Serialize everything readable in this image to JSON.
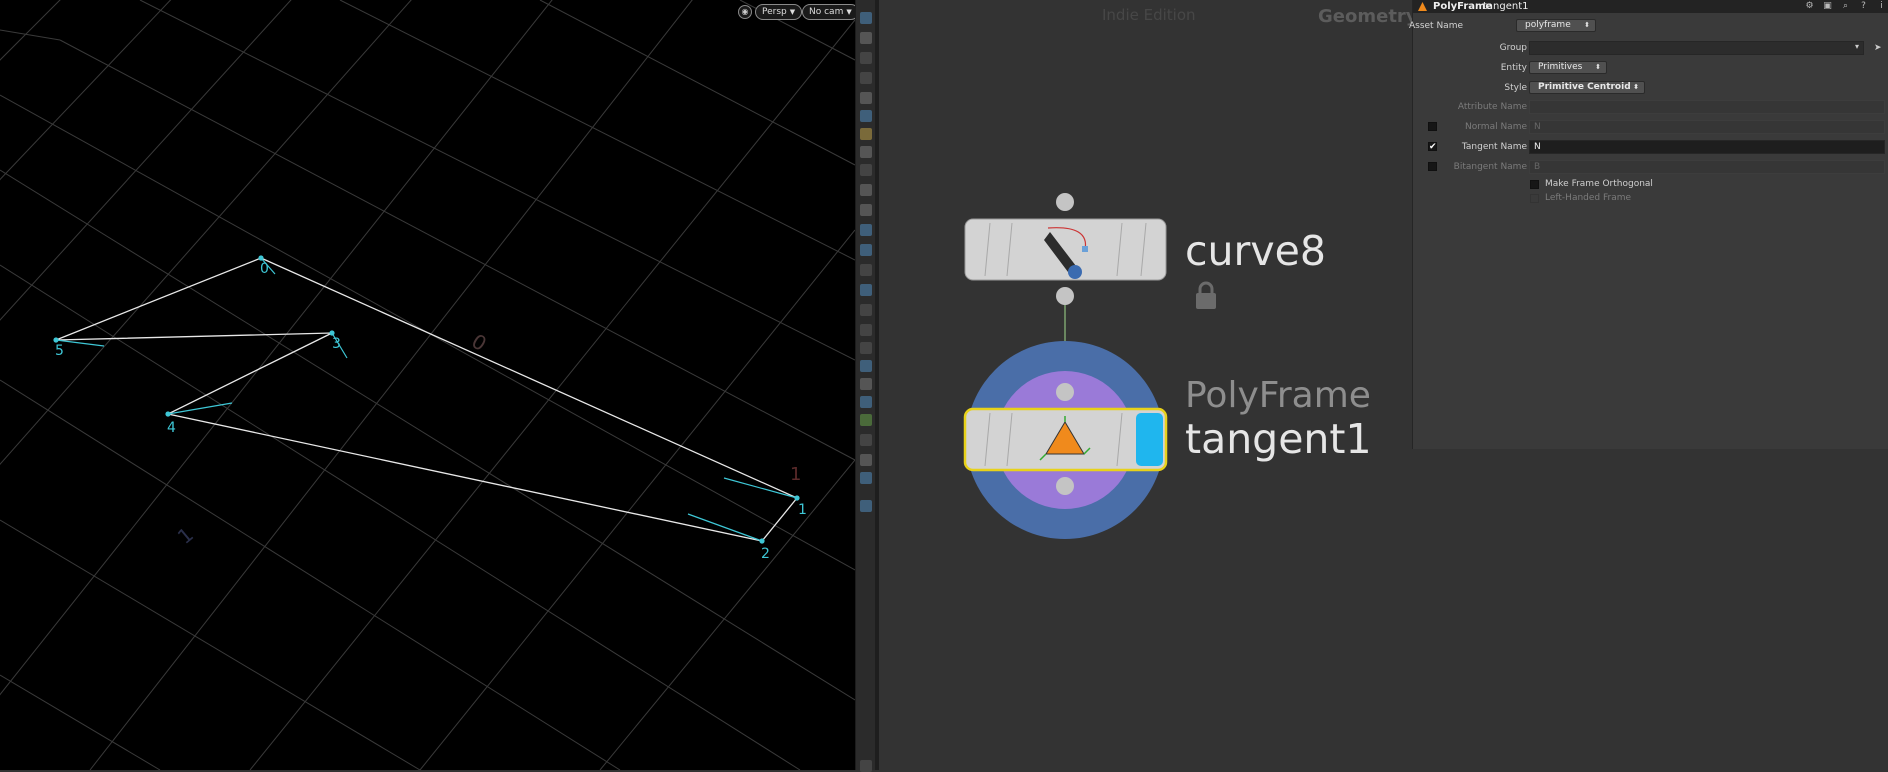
{
  "viewport": {
    "camera_menu": "Persp",
    "cam_menu": "No cam",
    "points": [
      "0",
      "1",
      "2",
      "3",
      "4",
      "5"
    ],
    "accent": "#3ec7d6"
  },
  "network": {
    "watermark": "Indie Edition",
    "context": "Geometry",
    "nodes": [
      {
        "name": "curve8",
        "icon": "pen-icon",
        "locked": true
      },
      {
        "type": "PolyFrame",
        "name": "tangent1",
        "icon": "triangle-icon",
        "display_flag": "#1fb6ee"
      }
    ]
  },
  "params": {
    "node_type": "PolyFrame",
    "node_name": "tangent1",
    "asset_name_label": "Asset Name",
    "asset_name_value": "polyframe",
    "group_label": "Group",
    "group_value": "",
    "entity_label": "Entity",
    "entity_value": "Primitives",
    "style_label": "Style",
    "style_value": "Primitive Centroid",
    "attribute_name_label": "Attribute Name",
    "normal_name_label": "Normal Name",
    "normal_name_value": "N",
    "tangent_name_label": "Tangent Name",
    "tangent_name_value": "N",
    "bitangent_name_label": "Bitangent Name",
    "bitangent_name_value": "B",
    "orthogonal_label": "Make Frame Orthogonal",
    "left_handed_label": "Left-Handed Frame",
    "check_mark": "✔"
  }
}
